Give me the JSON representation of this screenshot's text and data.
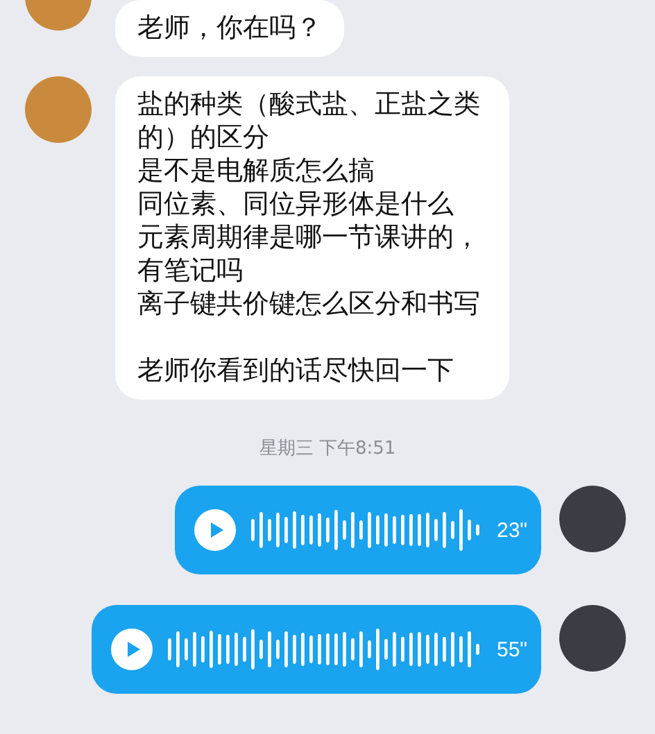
{
  "messages": [
    {
      "kind": "text",
      "outgoing": false,
      "paragraphs": [
        [
          "老师，你在吗？"
        ]
      ]
    },
    {
      "kind": "text",
      "outgoing": false,
      "paragraphs": [
        [
          "盐的种类（酸式盐、正盐之类的）的区分",
          "是不是电解质怎么搞",
          "同位素、同位异形体是什么",
          "元素周期律是哪一节课讲的，有笔记吗",
          "离子键共价键怎么区分和书写"
        ],
        [
          "老师你看到的话尽快回一下"
        ]
      ]
    },
    {
      "kind": "timestamp",
      "text": "星期三 下午8:51"
    },
    {
      "kind": "voice",
      "outgoing": true,
      "duration": "23\""
    },
    {
      "kind": "voice",
      "outgoing": true,
      "duration": "55\""
    }
  ]
}
